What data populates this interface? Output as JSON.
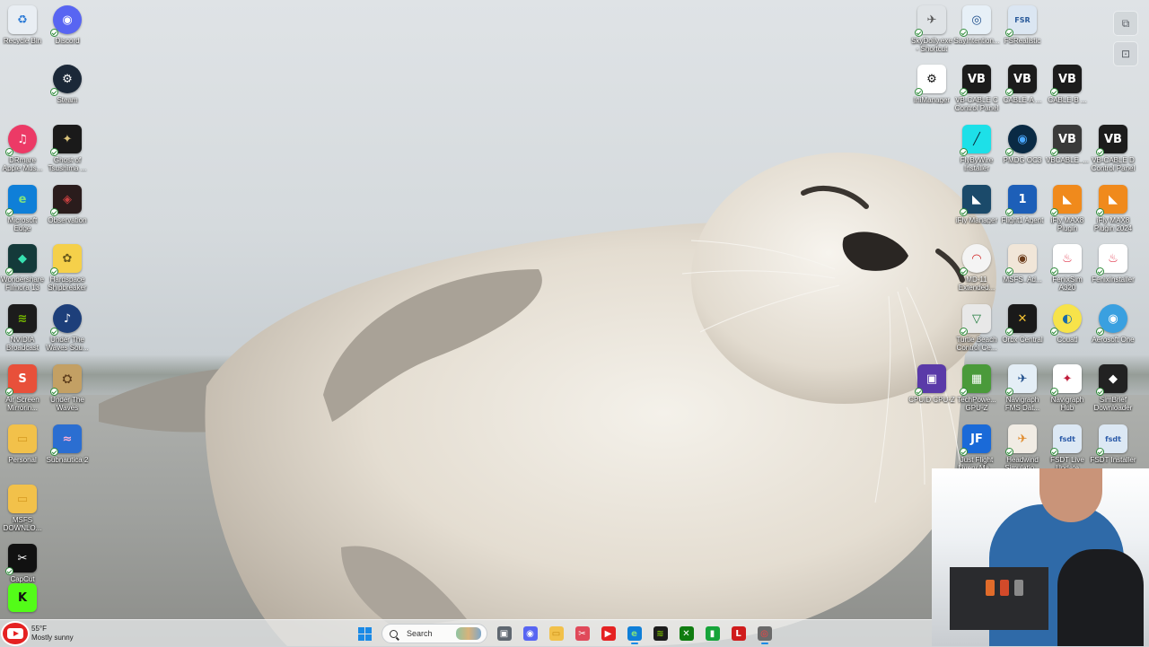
{
  "desktop": {
    "icons": [
      {
        "id": "recycle-bin",
        "label": "Recycle Bin",
        "glyph": "♻",
        "bg": "#e9eef3",
        "fg": "#2d7bd6"
      },
      {
        "id": "discord",
        "label": "Discord",
        "glyph": "◉",
        "bg": "#5865f2",
        "fg": "#ffffff"
      },
      {
        "id": "steam",
        "label": "Steam",
        "glyph": "⚙",
        "bg": "#1b2838",
        "fg": "#ffffff"
      },
      {
        "id": "drmare",
        "label": "DRmare\nApple Mus...",
        "glyph": "♫",
        "bg": "#ec3a66",
        "fg": "#ffffff"
      },
      {
        "id": "ghost-of-tsushima",
        "label": "Ghost of\nTsushima ...",
        "glyph": "✦",
        "bg": "#1a1a1a",
        "fg": "#d9c27a"
      },
      {
        "id": "microsoft-edge",
        "label": "Microsoft\nEdge",
        "glyph": "e",
        "bg": "#0f7fd8",
        "fg": "#7ee07f"
      },
      {
        "id": "observation",
        "label": "Observation",
        "glyph": "◈",
        "bg": "#2a1c1c",
        "fg": "#c94040"
      },
      {
        "id": "wondershare-filmora",
        "label": "Wondershare\nFilmora 13",
        "glyph": "◆",
        "bg": "#143a3a",
        "fg": "#37e0b0"
      },
      {
        "id": "hardspace-shipbreaker",
        "label": "Hardspace\nShipbreaker",
        "glyph": "✿",
        "bg": "#f5d04a",
        "fg": "#6a5a1c"
      },
      {
        "id": "nvidia-broadcast",
        "label": "NVIDIA\nBroadcast",
        "glyph": "≋",
        "bg": "#1c1c1c",
        "fg": "#76b900"
      },
      {
        "id": "under-the-waves-soundtrack",
        "label": "Under The\nWaves Sou...",
        "glyph": "♪",
        "bg": "#1d3f7a",
        "fg": "#ffffff"
      },
      {
        "id": "air-screen-mirroring",
        "label": "Air Screen\nMirrorin...",
        "glyph": "S",
        "bg": "#e8503a",
        "fg": "#ffffff"
      },
      {
        "id": "under-the-waves",
        "label": "Under The\nWaves",
        "glyph": "⛭",
        "bg": "#c3a064",
        "fg": "#5a3a1a"
      },
      {
        "id": "personal",
        "label": "Personal",
        "glyph": "▭",
        "bg": "#f2c14a",
        "fg": "#d69a20"
      },
      {
        "id": "subnautica-2",
        "label": "Subnautica 2",
        "glyph": "≈",
        "bg": "#2b6ed1",
        "fg": "#ffb1d6"
      },
      {
        "id": "msfs-downloads",
        "label": "MSFS\nDOWNLO...",
        "glyph": "▭",
        "bg": "#f2c14a",
        "fg": "#d69a20"
      },
      {
        "id": "capcut",
        "label": "CapCut",
        "glyph": "✂",
        "bg": "#111111",
        "fg": "#ffffff"
      },
      {
        "id": "kick",
        "label": "",
        "glyph": "K",
        "bg": "#53fc18",
        "fg": "#111111"
      },
      {
        "id": "skydolly",
        "label": "SkyDolly.exe\n- Shortcut",
        "glyph": "✈",
        "bg": "#dfe3e6",
        "fg": "#555555"
      },
      {
        "id": "sayintention",
        "label": "SayIntention...",
        "glyph": "◎",
        "bg": "#e7f0f7",
        "fg": "#1a4c8a"
      },
      {
        "id": "fsrealistic",
        "label": "FSRealistic",
        "glyph": "FSR",
        "bg": "#dbe6f2",
        "fg": "#2a5a9a"
      },
      {
        "id": "inimanager",
        "label": "IniManager",
        "glyph": "⚙",
        "bg": "#ffffff",
        "fg": "#111111"
      },
      {
        "id": "vb-cable-c-control",
        "label": "VB-CABLE C\nControl Panel",
        "glyph": "VB",
        "bg": "#1c1c1c",
        "fg": "#ffffff"
      },
      {
        "id": "cable-a-control",
        "label": "CABLE-A ...",
        "glyph": "VB",
        "bg": "#1c1c1c",
        "fg": "#ffffff"
      },
      {
        "id": "cable-b-control",
        "label": "CABLE-B ...",
        "glyph": "VB",
        "bg": "#1c1c1c",
        "fg": "#ffffff"
      },
      {
        "id": "flybywire-installer",
        "label": "FlyByWire\nInstaller",
        "glyph": "╱",
        "bg": "#1de0e8",
        "fg": "#0a2a3a"
      },
      {
        "id": "pmdg-ops",
        "label": "PMDG OC3",
        "glyph": "◉",
        "bg": "#0a2a44",
        "fg": "#4aa8ff"
      },
      {
        "id": "vb-cable",
        "label": "VBCABLE_...",
        "glyph": "VB",
        "bg": "#3a3a3a",
        "fg": "#ffffff"
      },
      {
        "id": "vb-cable-d-control",
        "label": "VB-CABLE D\nControl Panel",
        "glyph": "VB",
        "bg": "#1c1c1c",
        "fg": "#ffffff"
      },
      {
        "id": "ifly-manager",
        "label": "iFly Manager",
        "glyph": "◣",
        "bg": "#1b4a6a",
        "fg": "#ffffff"
      },
      {
        "id": "flight1-agent",
        "label": "Flight1 Agent",
        "glyph": "1",
        "bg": "#1d5fb8",
        "fg": "#ffffff"
      },
      {
        "id": "ifly-max8",
        "label": "iFly MAX8\nPlugin",
        "glyph": "◣",
        "bg": "#f08a1c",
        "fg": "#ffffff"
      },
      {
        "id": "ifly-max8-2024",
        "label": "iFly MAX8\nPlugin 2024",
        "glyph": "◣",
        "bg": "#f08a1c",
        "fg": "#ffffff"
      },
      {
        "id": "msfs-extended",
        "label": "MD-11\nExtended...",
        "glyph": "◠",
        "bg": "#f4f4f4",
        "fg": "#d01c1c"
      },
      {
        "id": "msfs-addons",
        "label": "MSFS_Ad...",
        "glyph": "◉",
        "bg": "#f1e6d8",
        "fg": "#6b3b1a"
      },
      {
        "id": "fenix-a320",
        "label": "FenixSim\nA320",
        "glyph": "♨",
        "bg": "#ffffff",
        "fg": "#e0344a"
      },
      {
        "id": "fenix-installer",
        "label": "FenixInstaller",
        "glyph": "♨",
        "bg": "#ffffff",
        "fg": "#e0344a"
      },
      {
        "id": "turtle-beach",
        "label": "Turtle Beach\nControl Ce...",
        "glyph": "▽",
        "bg": "#e8e8e8",
        "fg": "#1c7a3a"
      },
      {
        "id": "orbx-central",
        "label": "Orbx Central",
        "glyph": "✕",
        "bg": "#1a1a1a",
        "fg": "#f5c231"
      },
      {
        "id": "gsx-central",
        "label": "Couatl",
        "glyph": "◐",
        "bg": "#f7e34a",
        "fg": "#1a6aa8"
      },
      {
        "id": "aerosoft-one",
        "label": "Aerosoft One",
        "glyph": "◉",
        "bg": "#3aa0e0",
        "fg": "#ffffff"
      },
      {
        "id": "cpuid-cpu-z",
        "label": "CPUID CPU-Z",
        "glyph": "▣",
        "bg": "#5a3aa8",
        "fg": "#ffffff"
      },
      {
        "id": "techpowerup-gpu-z",
        "label": "TechPowe...\nGPU-Z",
        "glyph": "▦",
        "bg": "#4a9a3a",
        "fg": "#ffffff"
      },
      {
        "id": "navigraph-fms",
        "label": "Navigraph\nFMS Dat...",
        "glyph": "✈",
        "bg": "#e4eef6",
        "fg": "#1a4a8a"
      },
      {
        "id": "navigraph-hub",
        "label": "Navigraph\nHub",
        "glyph": "✦",
        "bg": "#ffffff",
        "fg": "#c01c3a"
      },
      {
        "id": "simbrief-downloader",
        "label": "SimBrief\nDownloader",
        "glyph": "◆",
        "bg": "#222222",
        "fg": "#ffffff"
      },
      {
        "id": "just-flight-livery",
        "label": "Just Flight\nLivery Ma...",
        "glyph": "JF",
        "bg": "#1a6ad8",
        "fg": "#ffffff"
      },
      {
        "id": "headwind-simulations",
        "label": "Headwind\nSimulatio...",
        "glyph": "✈",
        "bg": "#f1ece4",
        "fg": "#e08a2a"
      },
      {
        "id": "fsdt-live-update",
        "label": "FSDT Live\nUpdate",
        "glyph": "fsdt",
        "bg": "#dce8f4",
        "fg": "#2a5aa8"
      },
      {
        "id": "fsdt-installer",
        "label": "FSDT Installer",
        "glyph": "fsdt",
        "bg": "#dce8f4",
        "fg": "#2a5aa8"
      },
      {
        "id": "extra-app",
        "label": "",
        "glyph": "◉",
        "bg": "#0b3a5a",
        "fg": "#4ad0e8"
      }
    ]
  },
  "taskbar": {
    "weather": {
      "temp": "55°F",
      "condition": "Mostly sunny"
    },
    "search_placeholder": "Search",
    "pinned": [
      {
        "id": "task-view",
        "glyph": "▣",
        "bg": "#5f6770",
        "fg": "#ffffff"
      },
      {
        "id": "discord",
        "glyph": "◉",
        "bg": "#5865f2",
        "fg": "#ffffff"
      },
      {
        "id": "file-explorer",
        "glyph": "▭",
        "bg": "#f2c14a",
        "fg": "#c58a10"
      },
      {
        "id": "snipping-tool",
        "glyph": "✂",
        "bg": "#e04a5a",
        "fg": "#ffffff"
      },
      {
        "id": "youtube",
        "glyph": "▶",
        "bg": "#e52222",
        "fg": "#ffffff"
      },
      {
        "id": "edge",
        "glyph": "e",
        "bg": "#0f7fd8",
        "fg": "#7ee07f"
      },
      {
        "id": "nvidia",
        "glyph": "≋",
        "bg": "#1c1c1c",
        "fg": "#76b900"
      },
      {
        "id": "xbox",
        "glyph": "✕",
        "bg": "#107c10",
        "fg": "#ffffff"
      },
      {
        "id": "xbox-game-bar",
        "glyph": "▮",
        "bg": "#16a43a",
        "fg": "#ffffff"
      },
      {
        "id": "lenovo-vantage",
        "glyph": "L",
        "bg": "#d01c1c",
        "fg": "#ffffff"
      },
      {
        "id": "obs-recorder",
        "glyph": "◎",
        "bg": "#6a6a6a",
        "fg": "#ff4040"
      }
    ]
  },
  "colors": {
    "accent": "#1a8ae6",
    "taskbar_bg": "#eceef0"
  }
}
